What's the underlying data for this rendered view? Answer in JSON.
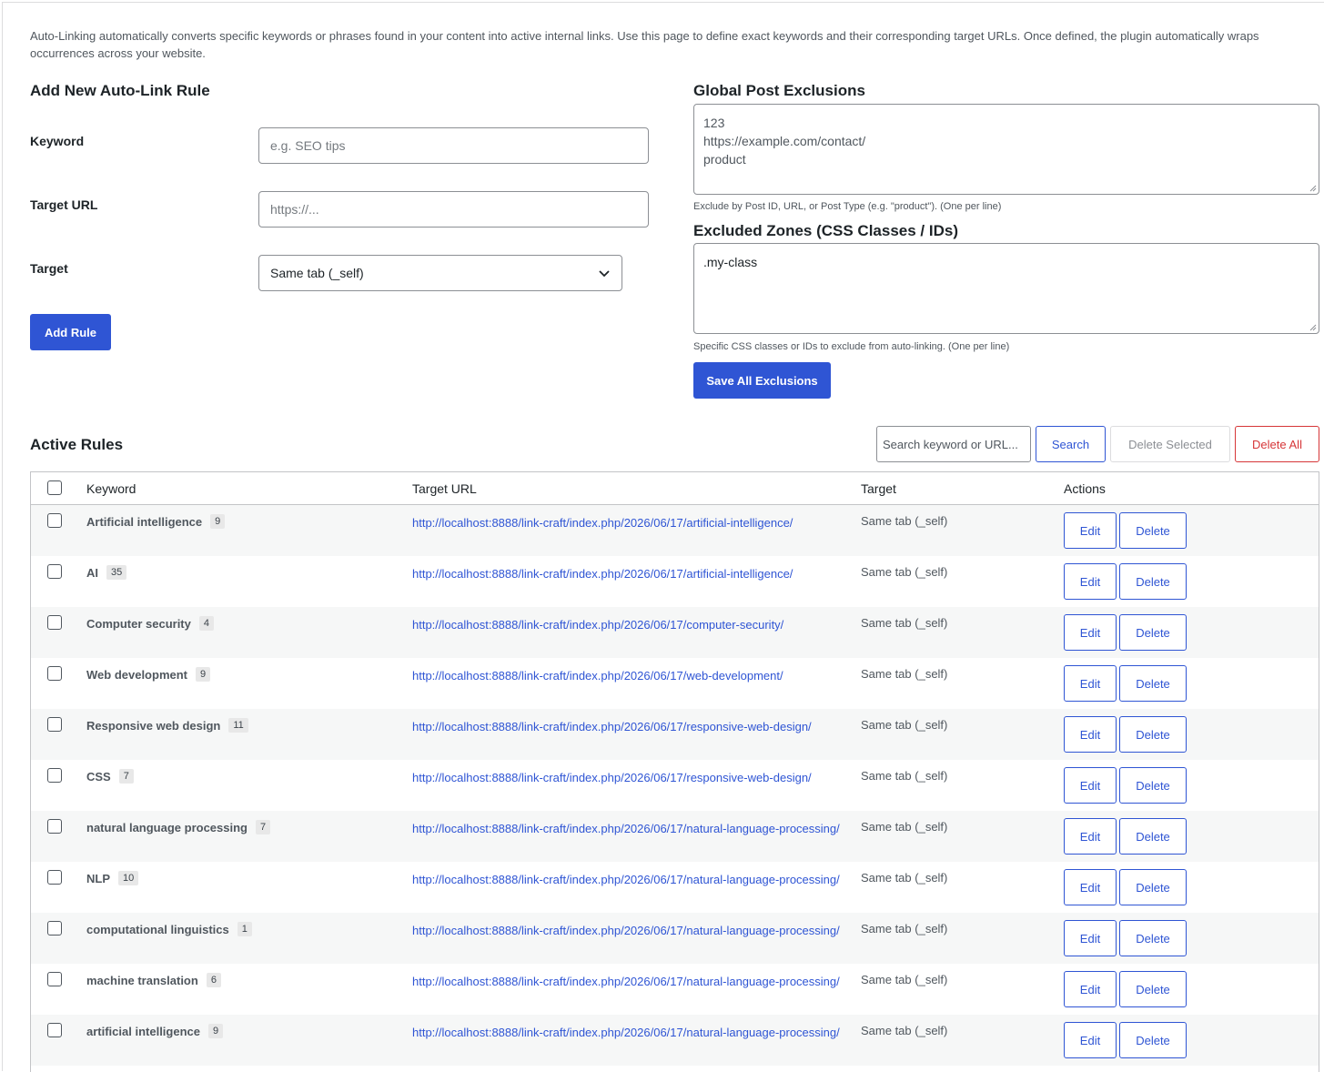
{
  "intro": "Auto-Linking automatically converts specific keywords or phrases found in your content into active internal links. Use this page to define exact keywords and their corresponding target URLs. Once defined, the plugin automatically wraps occurrences across your website.",
  "add_rule": {
    "title": "Add New Auto-Link Rule",
    "keyword_label": "Keyword",
    "keyword_placeholder": "e.g. SEO tips",
    "url_label": "Target URL",
    "url_placeholder": "https://...",
    "target_label": "Target",
    "target_value": "Same tab (_self)",
    "submit": "Add Rule"
  },
  "exclusions": {
    "post_title": "Global Post Exclusions",
    "post_lines": [
      "123",
      "https://example.com/contact/",
      "product"
    ],
    "post_help": "Exclude by Post ID, URL, or Post Type (e.g. \"product\"). (One per line)",
    "zones_title": "Excluded Zones (CSS Classes / IDs)",
    "zones_lines": [
      ".my-class"
    ],
    "zones_help": "Specific CSS classes or IDs to exclude from auto-linking. (One per line)",
    "save": "Save All Exclusions"
  },
  "active": {
    "title": "Active Rules",
    "search_placeholder": "Search keyword or URL...",
    "search_button": "Search",
    "delete_selected": "Delete Selected",
    "delete_all": "Delete All",
    "columns": {
      "keyword": "Keyword",
      "url": "Target URL",
      "target": "Target",
      "actions": "Actions"
    },
    "edit_label": "Edit",
    "delete_label": "Delete",
    "rows": [
      {
        "keyword": "Artificial intelligence",
        "count": "9",
        "url": "http://localhost:8888/link-craft/index.php/2026/06/17/artificial-intelligence/",
        "target": "Same tab (_self)"
      },
      {
        "keyword": "AI",
        "count": "35",
        "url": "http://localhost:8888/link-craft/index.php/2026/06/17/artificial-intelligence/",
        "target": "Same tab (_self)"
      },
      {
        "keyword": "Computer security",
        "count": "4",
        "url": "http://localhost:8888/link-craft/index.php/2026/06/17/computer-security/",
        "target": "Same tab (_self)"
      },
      {
        "keyword": "Web development",
        "count": "9",
        "url": "http://localhost:8888/link-craft/index.php/2026/06/17/web-development/",
        "target": "Same tab (_self)"
      },
      {
        "keyword": "Responsive web design",
        "count": "11",
        "url": "http://localhost:8888/link-craft/index.php/2026/06/17/responsive-web-design/",
        "target": "Same tab (_self)"
      },
      {
        "keyword": "CSS",
        "count": "7",
        "url": "http://localhost:8888/link-craft/index.php/2026/06/17/responsive-web-design/",
        "target": "Same tab (_self)"
      },
      {
        "keyword": "natural language processing",
        "count": "7",
        "url": "http://localhost:8888/link-craft/index.php/2026/06/17/natural-language-processing/",
        "target": "Same tab (_self)"
      },
      {
        "keyword": "NLP",
        "count": "10",
        "url": "http://localhost:8888/link-craft/index.php/2026/06/17/natural-language-processing/",
        "target": "Same tab (_self)"
      },
      {
        "keyword": "computational linguistics",
        "count": "1",
        "url": "http://localhost:8888/link-craft/index.php/2026/06/17/natural-language-processing/",
        "target": "Same tab (_self)"
      },
      {
        "keyword": "machine translation",
        "count": "6",
        "url": "http://localhost:8888/link-craft/index.php/2026/06/17/natural-language-processing/",
        "target": "Same tab (_self)"
      },
      {
        "keyword": "artificial intelligence",
        "count": "9",
        "url": "http://localhost:8888/link-craft/index.php/2026/06/17/natural-language-processing/",
        "target": "Same tab (_self)"
      }
    ]
  },
  "colors": {
    "primary": "#2f55d4",
    "danger": "#d63638",
    "row_alt": "#f6f7f7"
  }
}
